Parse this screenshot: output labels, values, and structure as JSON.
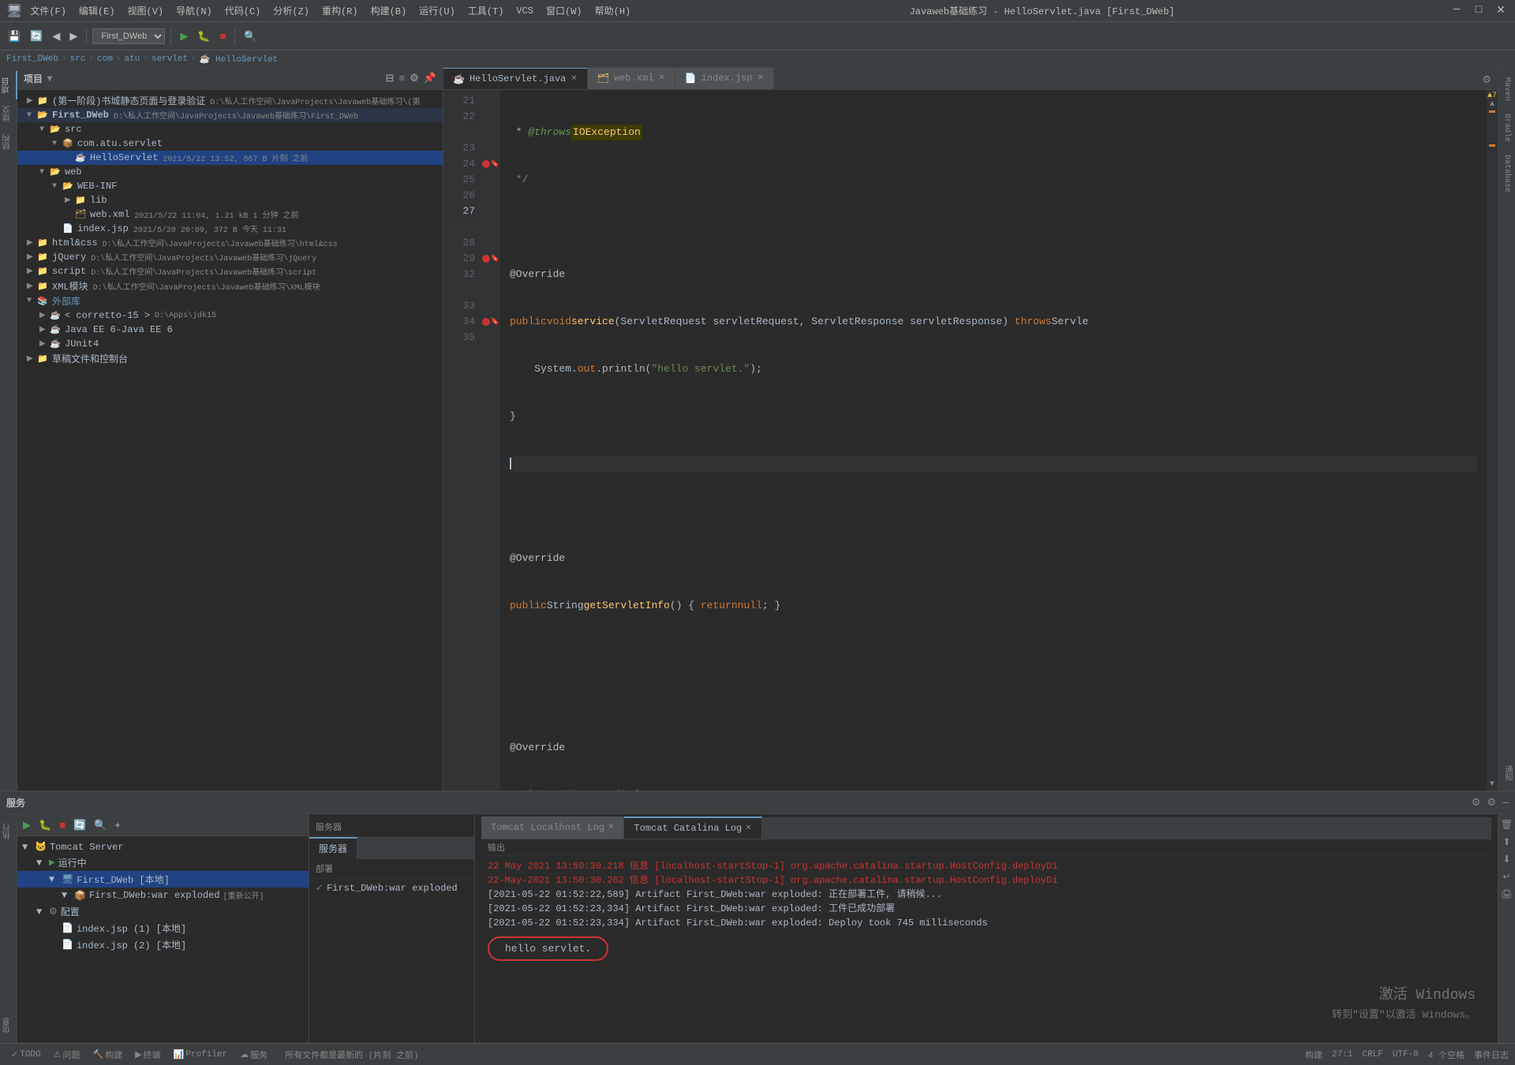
{
  "titlebar": {
    "title": "Javaweb基础练习 - HelloServlet.java [First_DWeb]",
    "min": "─",
    "max": "□",
    "close": "✕"
  },
  "menubar": {
    "items": [
      "文件(F)",
      "编辑(E)",
      "视图(V)",
      "导航(N)",
      "代码(C)",
      "分析(Z)",
      "重构(R)",
      "构建(B)",
      "运行(U)",
      "工具(T)",
      "VCS",
      "窗口(W)",
      "帮助(H)"
    ]
  },
  "breadcrumb": {
    "items": [
      "First_DWeb",
      "src",
      "com",
      "atu",
      "servlet",
      "HelloServlet"
    ]
  },
  "sidebar": {
    "header": "项目",
    "tree": [
      {
        "level": 0,
        "type": "folder",
        "name": "(第一阶段)书城静态页面与登录验证",
        "meta": "D:\\私人工作空间\\JavaProjects\\Javaweb基础练习\\(第",
        "expanded": false
      },
      {
        "level": 0,
        "type": "folder",
        "name": "First_DWeb",
        "meta": "D:\\私人工作空间\\JavaProjects\\Javaweb基础练习\\First_DWeb",
        "expanded": true,
        "selected": true
      },
      {
        "level": 1,
        "type": "folder",
        "name": "src",
        "expanded": true
      },
      {
        "level": 2,
        "type": "folder",
        "name": "com.atu.servlet",
        "expanded": true
      },
      {
        "level": 3,
        "type": "java",
        "name": "HelloServlet",
        "meta": "2021/5/22 13:52, 867 B 片刻 之前"
      },
      {
        "level": 1,
        "type": "folder",
        "name": "web",
        "expanded": true
      },
      {
        "level": 2,
        "type": "folder",
        "name": "WEB-INF",
        "expanded": true
      },
      {
        "level": 3,
        "type": "folder",
        "name": "lib",
        "expanded": false
      },
      {
        "level": 3,
        "type": "xml",
        "name": "web.xml",
        "meta": "2021/5/22 11:04, 1.21 kB 1 分钟 之前"
      },
      {
        "level": 2,
        "type": "jsp",
        "name": "index.jsp",
        "meta": "2021/5/20 20:09, 372 B 今天 11:31"
      },
      {
        "level": 0,
        "type": "folder",
        "name": "html&css",
        "meta": "D:\\私人工作空间\\JavaProjects\\Javaweb基础练习\\html&css",
        "expanded": false
      },
      {
        "level": 0,
        "type": "folder",
        "name": "jQuery",
        "meta": "D:\\私人工作空间\\JavaProjects\\Javaweb基础练习\\jQuery",
        "expanded": false
      },
      {
        "level": 0,
        "type": "folder",
        "name": "script",
        "meta": "D:\\私人工作空间\\JavaProjects\\Javaweb基础练习\\script",
        "expanded": false
      },
      {
        "level": 0,
        "type": "folder",
        "name": "XML模块",
        "meta": "D:\\私人工作空间\\JavaProjects\\Javaweb基础练习\\XML模块",
        "expanded": false
      },
      {
        "level": 0,
        "type": "lib",
        "name": "外部库",
        "expanded": true
      },
      {
        "level": 1,
        "type": "lib",
        "name": "< corretto-15 >",
        "meta": "D:\\Apps\\jdk15",
        "expanded": false
      },
      {
        "level": 1,
        "type": "lib",
        "name": "Java EE 6-Java EE 6",
        "expanded": false
      },
      {
        "level": 1,
        "type": "lib",
        "name": "JUnit4",
        "expanded": false
      },
      {
        "level": 0,
        "type": "folder",
        "name": "草稿文件和控制台",
        "expanded": false
      }
    ]
  },
  "editor": {
    "tabs": [
      {
        "name": "HelloServlet.java",
        "active": true,
        "icon": "☕"
      },
      {
        "name": "web.xml",
        "active": false,
        "icon": "📄"
      },
      {
        "name": "index.jsp",
        "active": false,
        "icon": "📄"
      }
    ],
    "lines": [
      {
        "num": 21,
        "gutter": "",
        "content": " * <span class='javadoc-tag'>@throws</span> <span class='annotation'>IOException</span>"
      },
      {
        "num": 22,
        "gutter": "",
        "content": " */"
      },
      {
        "num": 23,
        "gutter": "",
        "content": ""
      },
      {
        "num": 23,
        "gutter": "",
        "content": "<span class='annotation'>@Override</span>"
      },
      {
        "num": 24,
        "gutter": "dot",
        "content": "<span class='kw'>public</span> <span class='kw'>void</span> <span class='method-name'>service</span>(<span class='class-name'>ServletRequest</span> servletRequest, <span class='class-name'>ServletResponse</span> servletResponse) <span class='kw'>throws</span> Servle"
      },
      {
        "num": 25,
        "gutter": "",
        "content": "    System.<span class='kw2'>out</span>.println(<span class='str'>\"hello servlet.\"</span>);"
      },
      {
        "num": 26,
        "gutter": "",
        "content": "}"
      },
      {
        "num": 27,
        "gutter": "cursor",
        "content": ""
      },
      {
        "num": 28,
        "gutter": "",
        "content": ""
      },
      {
        "num": 28,
        "gutter": "",
        "content": "<span class='annotation'>@Override</span>"
      },
      {
        "num": 29,
        "gutter": "dot",
        "content": "<span class='kw'>public</span> <span class='kw'>String</span> <span class='method-name'>getServletInfo</span>() { <span class='kw'>return</span> <span class='kw'>null</span>; }"
      },
      {
        "num": 32,
        "gutter": "",
        "content": ""
      },
      {
        "num": 33,
        "gutter": "",
        "content": "<span class='annotation'>@Override</span>"
      },
      {
        "num": 34,
        "gutter": "dot",
        "content": "<span class='kw'>public</span> <span class='kw'>void</span> <span class='method-name'>destroy</span>() {"
      },
      {
        "num": 35,
        "gutter": "",
        "content": ""
      }
    ]
  },
  "bottom": {
    "title": "服务",
    "tabs": [
      {
        "name": "服务器",
        "active": false
      },
      {
        "name": "Tomcat Localhost Log",
        "active": false
      },
      {
        "name": "Tomcat Catalina Log",
        "active": true
      }
    ],
    "services_tree": [
      {
        "level": 0,
        "name": "Tomcat Server",
        "expanded": true
      },
      {
        "level": 1,
        "name": "运行中",
        "type": "running",
        "expanded": true
      },
      {
        "level": 2,
        "name": "First_DWeb [本地]",
        "expanded": true,
        "selected": true
      },
      {
        "level": 3,
        "name": "First_DWeb:war exploded",
        "meta": "[重新公开]"
      }
    ],
    "deploy_items": [
      {
        "name": "First_DWeb:war exploded",
        "status": "check"
      }
    ],
    "columns": {
      "server": "服务器",
      "deploy": "部署",
      "output": "输出"
    },
    "output_lines": [
      {
        "text": "22 May 2021 13:50:30.218 信息 [localhost-startStop-1] org.apache.catalina.startup.HostConfig.deployDi",
        "type": "red"
      },
      {
        "text": "22-May-2021 13:50:30.262 信息 [localhost-startStop-1] org.apache.catalina.startup.HostConfig.deployDi",
        "type": "red"
      },
      {
        "text": "[2021-05-22 01:52:22,589] Artifact First_DWeb:war exploded: 正在部署工件, 请稍候...",
        "type": "normal"
      },
      {
        "text": "[2021-05-22 01:52:23,334] Artifact First_DWeb:war exploded: 工件已成功部署",
        "type": "normal"
      },
      {
        "text": "[2021-05-22 01:52:23,334] Artifact First_DWeb:war exploded: Deploy took 745 milliseconds",
        "type": "normal"
      },
      {
        "text": "hello servlet.",
        "type": "hello"
      }
    ]
  },
  "statusbar": {
    "left": [
      "TODO",
      "⚠ 问题",
      "🔨 构建",
      "▶ 终端",
      "Profiler",
      "☁ 服务"
    ],
    "right": [
      "构建",
      "27:1",
      "CRLF",
      "UTF-8",
      "4 个空格",
      "事件日志"
    ],
    "file_info": "所有文件都是最新的 (片刻 之前)"
  },
  "watermark": {
    "line1": "激活 Windows",
    "line2": "转到\"设置\"以激活 Windows。"
  }
}
